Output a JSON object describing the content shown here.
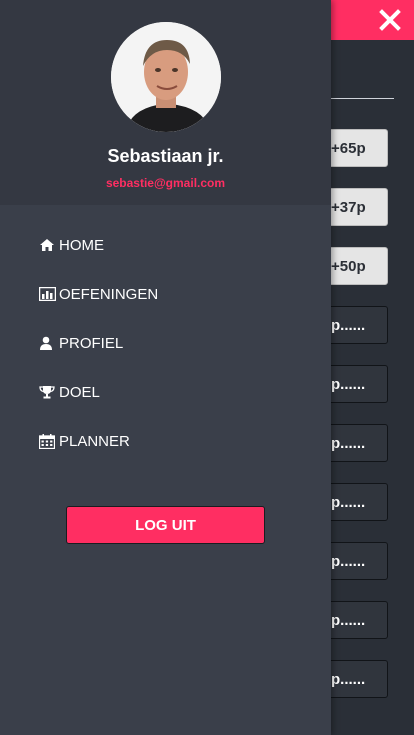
{
  "colors": {
    "accent": "#ff2e62",
    "drawer_background": "#3a3f4a",
    "profile_background": "#343842"
  },
  "header": {
    "close_icon": "close-x"
  },
  "background_list": [
    {
      "label": "+65p",
      "state": "done"
    },
    {
      "label": "+37p",
      "state": "done"
    },
    {
      "label": "+50p",
      "state": "done"
    },
    {
      "label": "p......",
      "state": "pending"
    },
    {
      "label": "p......",
      "state": "pending"
    },
    {
      "label": "p......",
      "state": "pending"
    },
    {
      "label": "p......",
      "state": "pending"
    },
    {
      "label": "p......",
      "state": "pending"
    },
    {
      "label": "p......",
      "state": "pending"
    },
    {
      "label": "p......",
      "state": "pending"
    }
  ],
  "drawer": {
    "user": {
      "name": "Sebastiaan jr.",
      "email": "sebastie@gmail.com"
    },
    "menu": [
      {
        "label": "HOME",
        "icon": "home-icon"
      },
      {
        "label": "OEFENINGEN",
        "icon": "bar-chart-icon"
      },
      {
        "label": "PROFIEL",
        "icon": "user-icon"
      },
      {
        "label": "DOEL",
        "icon": "trophy-icon"
      },
      {
        "label": "PLANNER",
        "icon": "calendar-icon"
      }
    ],
    "logout_label": "LOG UIT"
  }
}
